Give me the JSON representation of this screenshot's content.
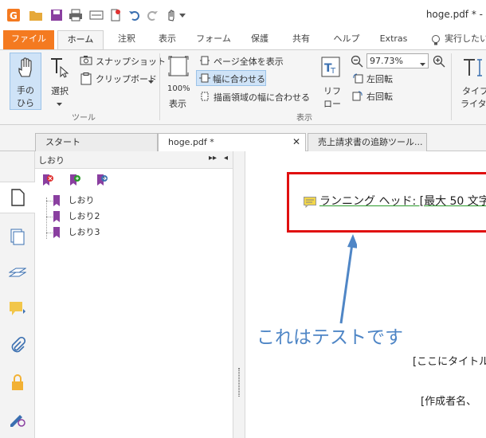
{
  "window": {
    "title": "hoge.pdf * -"
  },
  "menu_tabs": [
    "ファイル",
    "ホーム",
    "注釈",
    "表示",
    "フォーム",
    "保護",
    "共有",
    "ヘルプ",
    "Extras"
  ],
  "tell_me": "実行したい",
  "ribbon": {
    "hand_tool": "手の\nひら",
    "hand_line1": "手の",
    "hand_line2": "ひら",
    "select_tool": "選択",
    "snapshot": "スナップショット",
    "clipboard": "クリップボード",
    "tools_group": "ツール",
    "actual_size_line1": "100%",
    "actual_size_line2": "表示",
    "fit_page": "ページ全体を表示",
    "fit_width": "幅に合わせる",
    "fit_visible": "描画領域の幅に合わせる",
    "reflow_line1": "リフ",
    "reflow_line2": "ロー",
    "zoom_value": "97.73%",
    "rotate_left": "左回転",
    "rotate_right": "右回転",
    "view_group": "表示",
    "typewriter_line1": "タイプ",
    "typewriter_line2": "ライター"
  },
  "doc_tabs": [
    {
      "label": "スタート",
      "active": false
    },
    {
      "label": "hoge.pdf *",
      "active": true
    },
    {
      "label": "売上請求書の追跡ツール...",
      "active": false
    }
  ],
  "bookmarks_panel": {
    "title": "しおり",
    "items": [
      "しおり",
      "しおり2",
      "しおり3"
    ]
  },
  "document": {
    "running_head": "ランニング ヘッド: [最大 50 文字",
    "annotation_text": "これはテストです",
    "title_placeholder": "[ここにタイトルを",
    "author_placeholder": "[作成者名、"
  },
  "colors": {
    "accent": "#f47a20",
    "highlight_box": "#e01010",
    "annotation": "#4f86c6"
  }
}
